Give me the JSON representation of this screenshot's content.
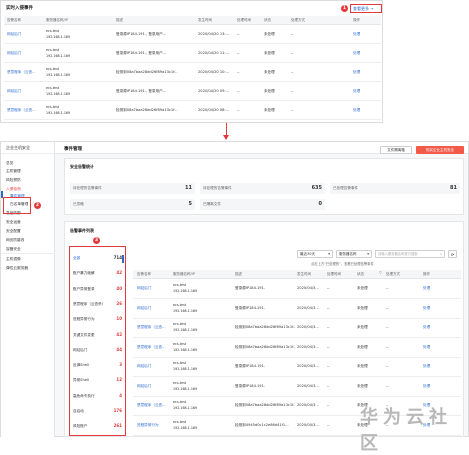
{
  "top": {
    "title": "实时入侵事件",
    "more": "查看更多 →",
    "badge": "1",
    "headers": [
      "告警名称",
      "服务器名称/IP",
      "描述",
      "发生时间",
      "处理时间",
      "状态",
      "处理方式",
      "操作"
    ],
    "rows": [
      {
        "name": "网站后门",
        "host": "ecs-test",
        "ip": "192.168.1.169",
        "desc": "登录源IP",
        "desc_ip": "184.191.",
        "desc2": ", 登录用户...",
        "time": "2020/04/20 13:...",
        "ptime": "--",
        "status": "未处理",
        "method": "--",
        "op": "处理"
      },
      {
        "name": "网站后门",
        "host": "ecs-test",
        "ip": "192.168.1.169",
        "desc": "登录源IP",
        "desc_ip": "184.191.",
        "desc2": ", 登录用户...",
        "time": "2020/04/20 11:...",
        "ptime": "--",
        "status": "未处理",
        "method": "--",
        "op": "处理"
      },
      {
        "name": "恶意程序（云查...",
        "host": "ecs-test",
        "ip": "192.168.1.169",
        "desc": "检测到08a7baa28dd26f89a13c1f...",
        "desc_ip": "",
        "desc2": "",
        "time": "2020/04/20 10:...",
        "ptime": "--",
        "status": "未处理",
        "method": "--",
        "op": "处理"
      },
      {
        "name": "网站后门",
        "host": "ecs-test",
        "ip": "192.168.1.169",
        "desc": "登录源IP",
        "desc_ip": "184.191.",
        "desc2": ", 登录用户...",
        "time": "2020/04/20 09:...",
        "ptime": "--",
        "status": "未处理",
        "method": "--",
        "op": "处理"
      },
      {
        "name": "恶意程序（云查...",
        "host": "ecs-test",
        "ip": "192.168.1.169",
        "desc": "检测到08a7baa28dd26f89a13c1f...",
        "desc_ip": "",
        "desc2": "",
        "time": "2020/04/20 08:...",
        "ptime": "--",
        "status": "未处理",
        "method": "--",
        "op": "处理"
      }
    ]
  },
  "sidebar": {
    "title": "企业主机安全",
    "items": [
      "总览",
      "主机管理",
      "风险预防",
      "入侵检测",
      "事件管理",
      "白名单管理",
      "高级防御",
      "安全运营",
      "安全配置",
      "网页防篡改",
      "容器安全",
      "主机镜像",
      "弹性云服务器"
    ],
    "badge": "2"
  },
  "main": {
    "title": "事件管理",
    "export_btn": "文件隔离箱",
    "buy_btn": "购买企业主机安全",
    "stats_title": "安全告警统计",
    "stats": [
      {
        "label": "待处理的告警事件",
        "value": "11"
      },
      {
        "label": "待处理的告警事件",
        "value": "635"
      },
      {
        "label": "已处理告警事件",
        "value": "81"
      },
      {
        "label": "已忽略",
        "value": "5"
      },
      {
        "label": "已隔离文件",
        "value": "0"
      }
    ],
    "list_title": "告警事件列表",
    "badge": "3",
    "time_select": "最近30天",
    "server_select": "服务器名称",
    "search_placeholder": "请输入服务器名称进行搜索",
    "hint": "点击上方“已处理的”，查看已处理告警事件",
    "categories": [
      {
        "label": "全部",
        "count": "714"
      },
      {
        "label": "账户暴力破解",
        "count": "42"
      },
      {
        "label": "账户异常登录",
        "count": "40"
      },
      {
        "label": "恶意程序（云查杀）",
        "count": "26"
      },
      {
        "label": "进程异常行为",
        "count": "10"
      },
      {
        "label": "关键文件变更",
        "count": "42"
      },
      {
        "label": "网站后门",
        "count": "44"
      },
      {
        "label": "反弹Shell",
        "count": "3"
      },
      {
        "label": "异常Shell",
        "count": "12"
      },
      {
        "label": "高危命令执行",
        "count": "4"
      },
      {
        "label": "自启动",
        "count": "176"
      },
      {
        "label": "风险账户",
        "count": "261"
      }
    ],
    "headers": [
      "告警名称",
      "服务器名称/IP",
      "描述",
      "发生时间",
      "处理时间",
      "状态",
      "处理方式",
      "操作"
    ],
    "rows": [
      {
        "name": "网站后门",
        "host": "ecs-test",
        "ip": "192.168.1.169",
        "desc": "登录源IP",
        "desc_ip": "184.191.",
        "time": "2020/04/3...",
        "ptime": "--",
        "status": "未处理",
        "method": "--",
        "op": "处理"
      },
      {
        "name": "网站后门",
        "host": "ecs-test",
        "ip": "192.168.1.169",
        "desc": "登录源IP",
        "desc_ip": "184.191.",
        "time": "2020/04/3...",
        "ptime": "--",
        "status": "未处理",
        "method": "--",
        "op": "处理"
      },
      {
        "name": "恶意程序（云查...",
        "host": "ecs-test",
        "ip": "192.168.1.169",
        "desc": "检测到08a7baa28dd26f89a13c1f...",
        "desc_ip": "",
        "time": "2020/04/3...",
        "ptime": "--",
        "status": "未处理",
        "method": "--",
        "op": "处理"
      },
      {
        "name": "恶意程序（云查...",
        "host": "ecs-test",
        "ip": "192.168.1.169",
        "desc": "检测到08a7baa28dd26f89a13c1f...",
        "desc_ip": "",
        "time": "2020/04/3...",
        "ptime": "--",
        "status": "未处理",
        "method": "--",
        "op": "处理"
      },
      {
        "name": "网站后门",
        "host": "ecs-test",
        "ip": "192.168.1.169",
        "desc": "登录源IP",
        "desc_ip": "184.191.",
        "time": "2020/04/3...",
        "ptime": "--",
        "status": "未处理",
        "method": "--",
        "op": "处理"
      },
      {
        "name": "网站后门",
        "host": "ecs-test",
        "ip": "192.168.1.169",
        "desc": "登录源IP",
        "desc_ip": "184.191.",
        "time": "2020/04/3...",
        "ptime": "--",
        "status": "未处理",
        "method": "--",
        "op": "处理"
      },
      {
        "name": "恶意程序（云查...",
        "host": "ecs-test",
        "ip": "192.168.1.169",
        "desc": "检测到08a7baa28dd26f89a13c1f...",
        "desc_ip": "",
        "time": "2020/04/3...",
        "ptime": "--",
        "status": "未处理",
        "method": "--",
        "op": "处理"
      },
      {
        "name": "进程异常行为",
        "host": "ecs-test",
        "ip": "192.168.1.169",
        "desc": "检测到4945d0c1c2e86d41f1...",
        "desc_ip": "",
        "time": "2020/04/3...",
        "ptime": "--",
        "status": "未处理",
        "method": "--",
        "op": "处理"
      }
    ]
  },
  "watermark": "华为云社区",
  "colors": {
    "accent": "#e4393c",
    "link": "#2a6ad1",
    "buy": "#f25a4a"
  }
}
